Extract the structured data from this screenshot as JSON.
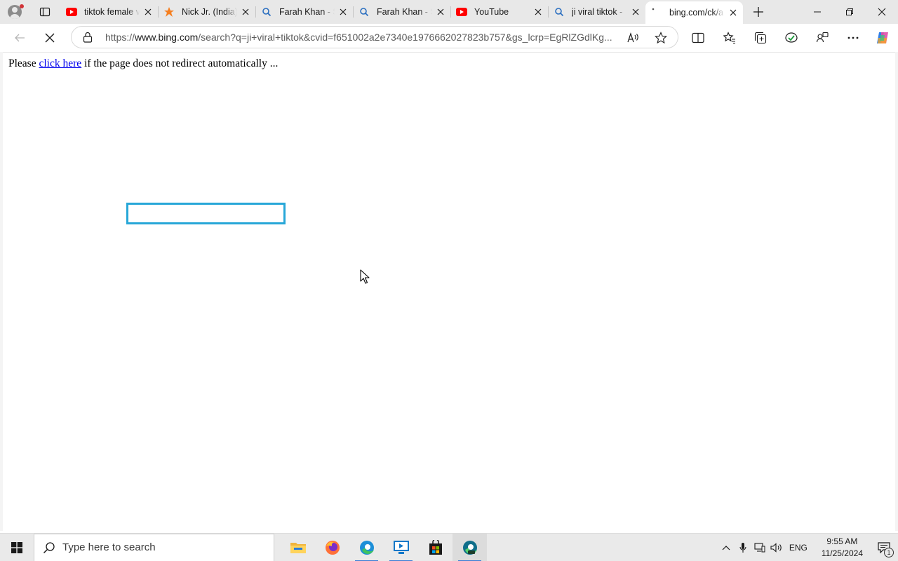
{
  "browser": {
    "tabs": [
      {
        "title": "tiktok female v",
        "icon": "youtube-icon",
        "active": false
      },
      {
        "title": "Nick Jr. (India)",
        "icon": "nick-jr-icon",
        "active": false
      },
      {
        "title": "Farah Khan - Se",
        "icon": "search-icon",
        "active": false
      },
      {
        "title": "Farah Khan - Se",
        "icon": "search-icon",
        "active": false
      },
      {
        "title": "YouTube",
        "icon": "youtube-icon",
        "active": false
      },
      {
        "title": "ji viral tiktok -",
        "icon": "search-icon",
        "active": false
      },
      {
        "title": "bing.com/ck/a",
        "icon": "loading-icon",
        "active": true
      }
    ],
    "address_bar": {
      "url_prefix": "https://",
      "url_host": "www.bing.com",
      "url_rest": "/search?q=ji+viral+tiktok&cvid=f651002a2e7340e1976662027823b757&gs_lcrp=EgRlZGdlKg..."
    }
  },
  "page": {
    "redirect_prefix": "Please ",
    "redirect_link": "click here",
    "redirect_suffix": " if the page does not redirect automatically ..."
  },
  "taskbar": {
    "search_placeholder": "Type here to search",
    "apps": [
      "file-explorer-icon",
      "firefox-icon",
      "edge-icon",
      "remote-desktop-icon",
      "store-icon",
      "edge-dev-icon"
    ],
    "language": "ENG",
    "time": "9:55 AM",
    "date": "11/25/2024",
    "notification_count": "1"
  },
  "colors": {
    "accent": "#27a7d8",
    "link": "#0000ee",
    "youtube_red": "#ff0000",
    "nick_orange": "#f57f20"
  }
}
